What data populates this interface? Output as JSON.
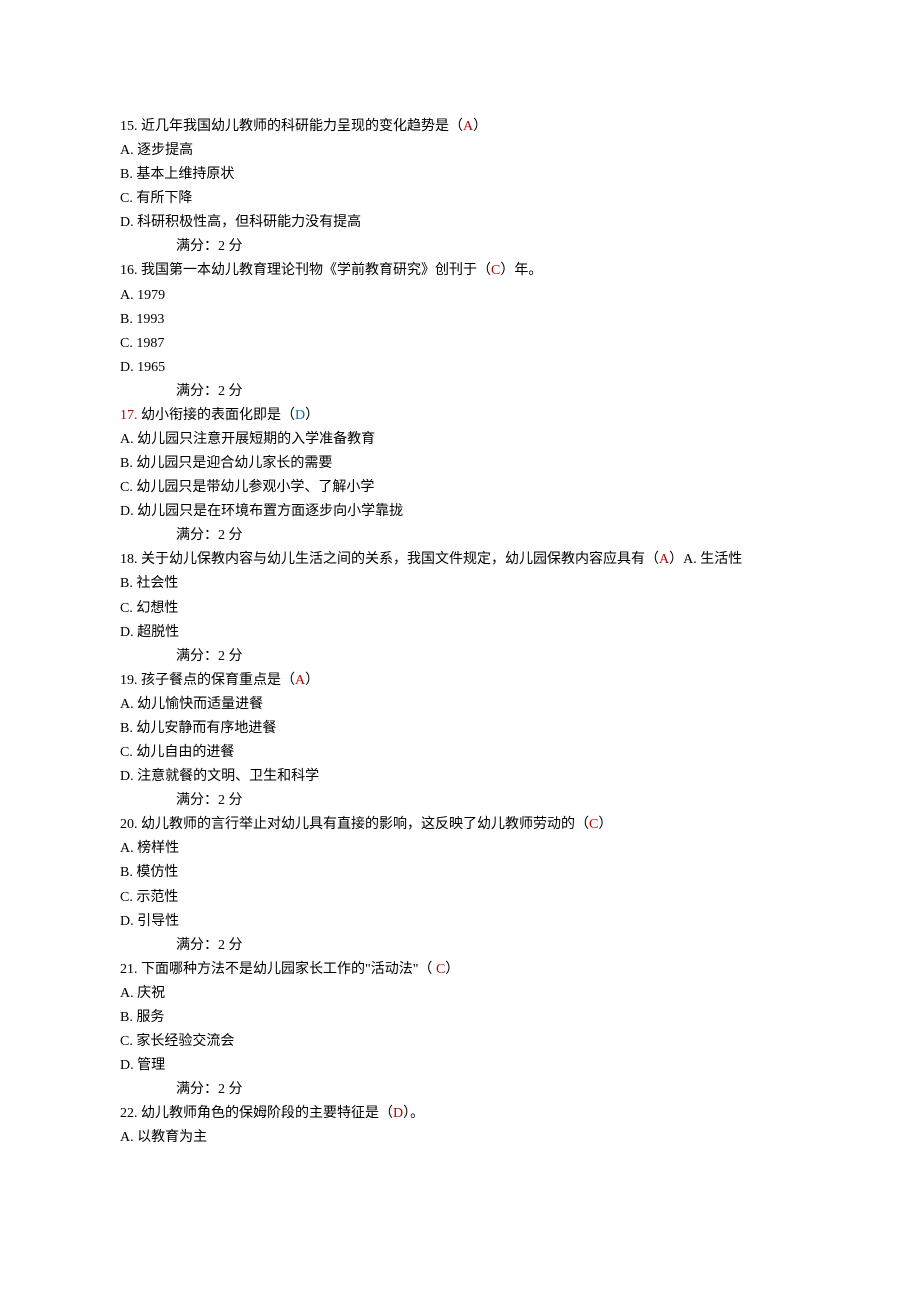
{
  "questions": [
    {
      "number": "15.",
      "text": "近几年我国幼儿教师的科研能力呈现的变化趋势是（",
      "answer": "A",
      "text_after": "）",
      "options": [
        "A. 逐步提高",
        "B. 基本上维持原状",
        "C. 有所下降",
        "D. 科研积极性高，但科研能力没有提高"
      ],
      "score": "满分：2   分"
    },
    {
      "number": "16.",
      "text": "我国第一本幼儿教育理论刊物《学前教育研究》创刊于（",
      "answer": "C",
      "text_after": "）年。",
      "options": [
        "A. 1979",
        "B. 1993",
        "C. 1987",
        "D. 1965"
      ],
      "score": "满分：2   分"
    },
    {
      "number": "17.",
      "number_style": "red",
      "text": "幼小衔接的表面化即是（",
      "answer": "D",
      "answer_style": "blue",
      "text_after": "）",
      "options": [
        "A. 幼儿园只注意开展短期的入学准备教育",
        "B. 幼儿园只是迎合幼儿家长的需要",
        "C. 幼儿园只是带幼儿参观小学、了解小学",
        "D. 幼儿园只是在环境布置方面逐步向小学靠拢"
      ],
      "score": "满分：2   分"
    },
    {
      "number": "18.",
      "text": "关于幼儿保教内容与幼儿生活之间的关系，我国文件规定，幼儿园保教内容应具有（",
      "answer": "A",
      "text_after": "）A. 生活性",
      "options": [
        "B. 社会性",
        "C. 幻想性",
        "D. 超脱性"
      ],
      "score": "满分：2   分"
    },
    {
      "number": "19.",
      "text": "孩子餐点的保育重点是（",
      "answer": "A",
      "text_after": "）",
      "options": [
        "A. 幼儿愉快而适量进餐",
        "B. 幼儿安静而有序地进餐",
        "C. 幼儿自由的进餐",
        "D. 注意就餐的文明、卫生和科学"
      ],
      "score": "满分：2   分"
    },
    {
      "number": "20.",
      "text": "幼儿教师的言行举止对幼儿具有直接的影响，这反映了幼儿教师劳动的（",
      "answer": "C",
      "text_after": "）",
      "options": [
        "A. 榜样性",
        "B. 模仿性",
        "C. 示范性",
        "D. 引导性"
      ],
      "score": "满分：2   分"
    },
    {
      "number": "21.",
      "text": "下面哪种方法不是幼儿园家长工作的\"活动法\"（ ",
      "answer": "C",
      "text_after": "）",
      "options": [
        "A. 庆祝",
        "B. 服务",
        "C. 家长经验交流会",
        "D. 管理"
      ],
      "score": "满分：2   分"
    },
    {
      "number": "22.",
      "text": "幼儿教师角色的保姆阶段的主要特征是（",
      "answer": "D",
      "text_after": "）。",
      "options": [
        "A. 以教育为主"
      ],
      "score": ""
    }
  ]
}
